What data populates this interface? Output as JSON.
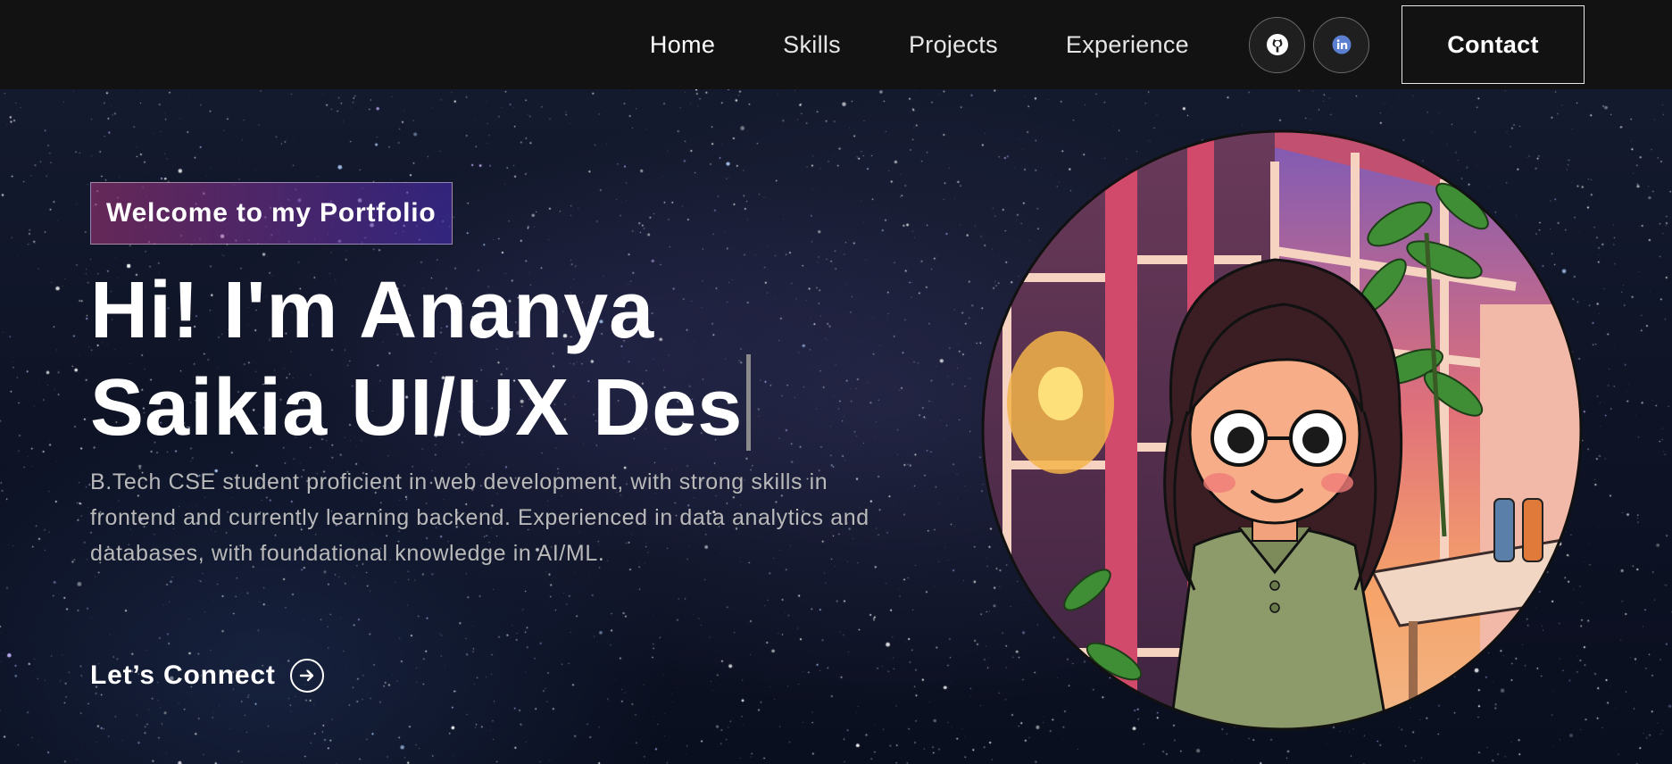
{
  "nav": {
    "links": [
      "Home",
      "Skills",
      "Projects",
      "Experience"
    ],
    "github_icon": "github-icon",
    "linkedin_icon": "linkedin-icon",
    "contact_label": "Contact"
  },
  "hero": {
    "welcome": "Welcome to my Portfolio",
    "title_line1": "Hi! I'm Ananya",
    "title_line2": "Saikia UI/UX Des",
    "description": "B.Tech CSE student proficient in web development, with strong skills in frontend and currently learning backend. Experienced in data analytics and databases, with foundational knowledge in AI/ML.",
    "cta_label": "Let’s Connect",
    "cta_icon": "arrow-right-circle-icon"
  },
  "colors": {
    "navbar_bg": "#121212",
    "welcome_gradient_start": "#aa367c",
    "welcome_gradient_end": "#4a2fbd",
    "description_text": "#b9b9b9"
  }
}
